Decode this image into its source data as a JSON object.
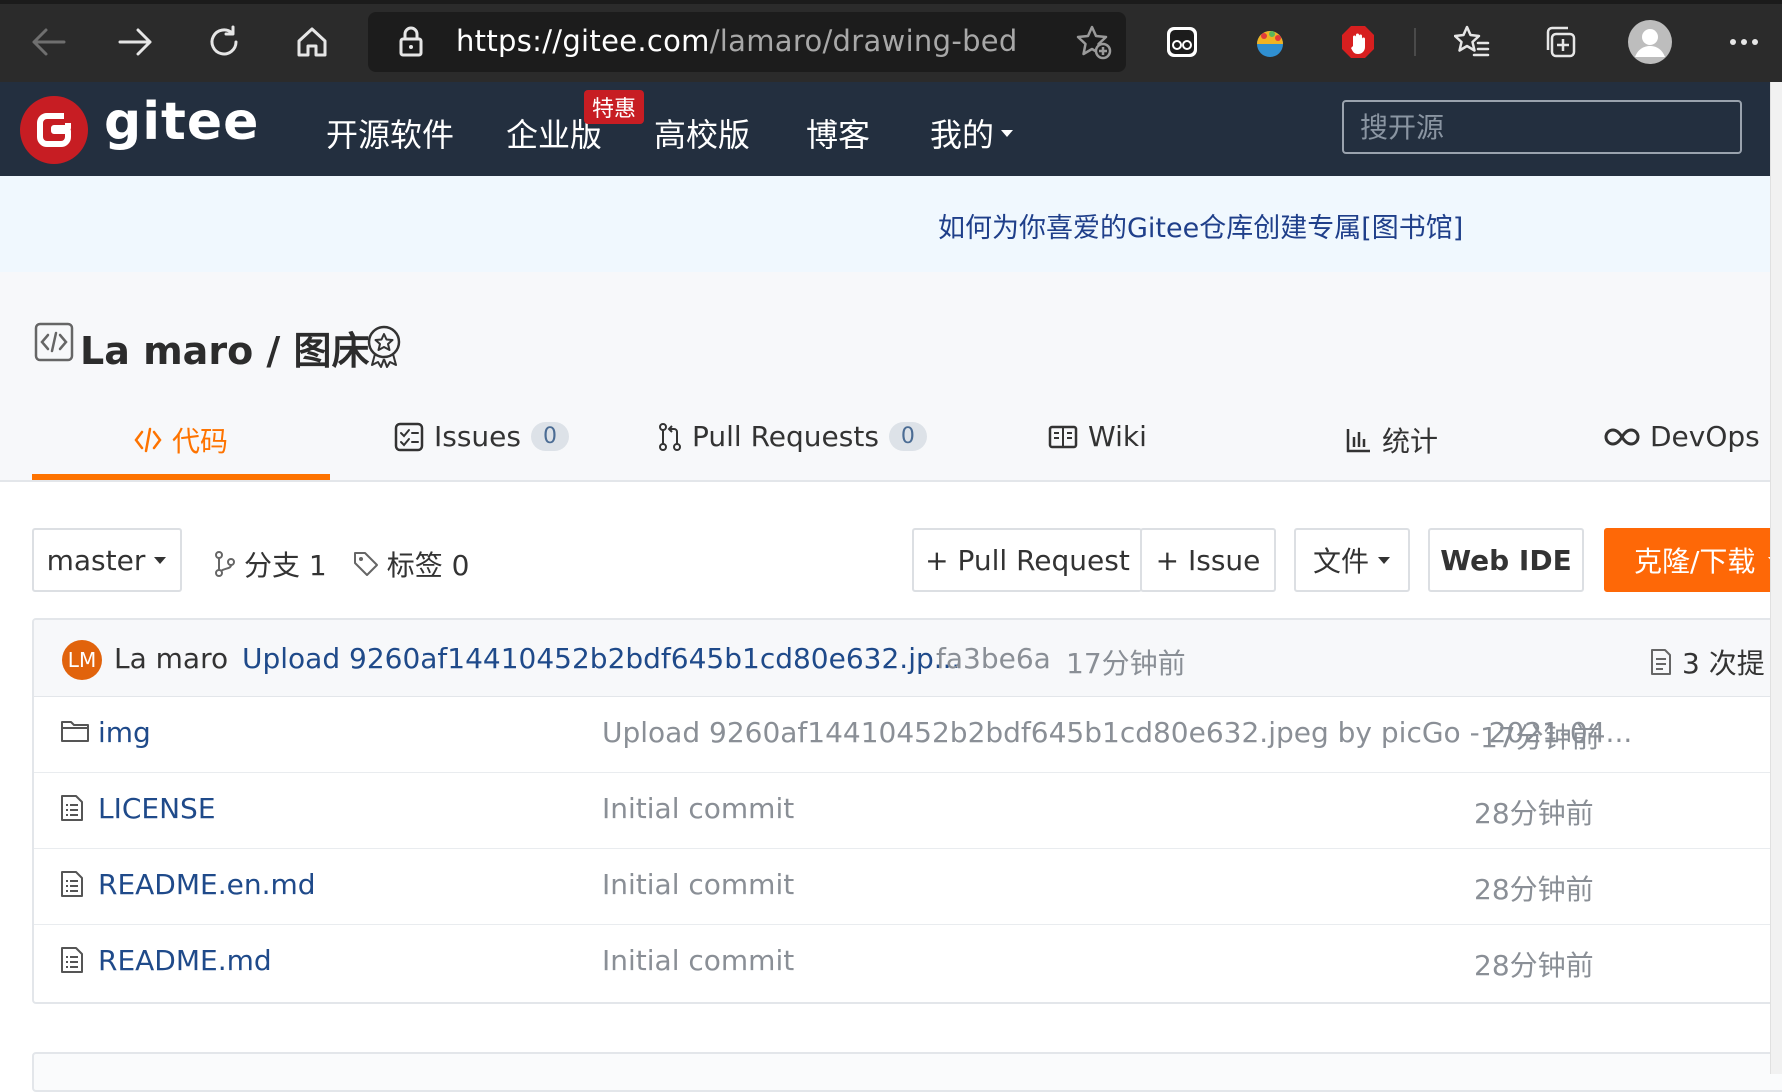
{
  "browser": {
    "url_host": "https://gitee.com",
    "url_path": "/lamaro/drawing-bed"
  },
  "header": {
    "logo_letter": "G",
    "logo_text": "gitee",
    "nav": [
      "开源软件",
      "企业版",
      "高校版",
      "博客",
      "我的"
    ],
    "promo_badge": "特惠",
    "search_placeholder": "搜开源"
  },
  "notice": {
    "text": "如何为你喜爱的Gitee仓库创建专属[图书馆]"
  },
  "project": {
    "title": "La maro / 图床",
    "tabs": [
      {
        "label": "代码",
        "active": true
      },
      {
        "label": "Issues",
        "count": "0"
      },
      {
        "label": "Pull Requests",
        "count": "0"
      },
      {
        "label": "Wiki"
      },
      {
        "label": "统计"
      },
      {
        "label": "DevOps"
      }
    ],
    "accent_color": "#fe7300"
  },
  "toolbar": {
    "branch": "master",
    "branches_label": "分支 1",
    "tags_label": "标签 0",
    "pr_button": "+ Pull Request",
    "issue_button": "+ Issue",
    "file_button": "文件",
    "webide_button": "Web IDE",
    "clone_button": "克隆/下载"
  },
  "commit": {
    "avatar_initials": "LM",
    "author": "La maro",
    "message": "Upload 9260af14410452b2bdf645b1cd80e632.jp...",
    "hash": "fa3be6a",
    "time": "17分钟前",
    "count_label": "3 次提"
  },
  "files": [
    {
      "type": "folder",
      "name": "img",
      "message": "Upload 9260af14410452b2bdf645b1cd80e632.jpeg by picGo - 2021-04...",
      "time": "17分钟前"
    },
    {
      "type": "file",
      "name": "LICENSE",
      "message": "Initial commit",
      "time": "28分钟前"
    },
    {
      "type": "file",
      "name": "README.en.md",
      "message": "Initial commit",
      "time": "28分钟前"
    },
    {
      "type": "file",
      "name": "README.md",
      "message": "Initial commit",
      "time": "28分钟前"
    }
  ]
}
